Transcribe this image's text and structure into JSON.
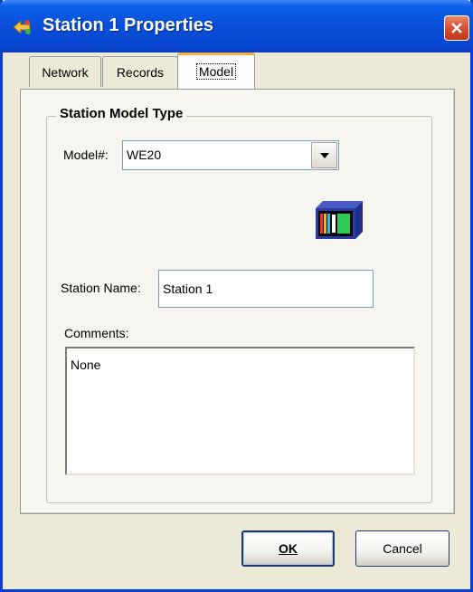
{
  "window": {
    "title": "Station 1 Properties",
    "close_glyph": "✕"
  },
  "tabs": [
    {
      "label": "Network",
      "active": false
    },
    {
      "label": "Records",
      "active": false
    },
    {
      "label": "Model",
      "active": true
    }
  ],
  "model_tab": {
    "group_title": "Station Model Type",
    "model_label": "Model#:",
    "model_value": "WE20",
    "station_name_label": "Station Name:",
    "station_name_value": "Station 1",
    "comments_label": "Comments:",
    "comments_value": "None"
  },
  "buttons": {
    "ok_label": "OK",
    "cancel_label": "Cancel"
  },
  "icons": {
    "title": "station-properties-icon",
    "model_image": "station-device-icon",
    "dropdown": "dropdown-arrow-icon",
    "close": "close-icon"
  },
  "colors": {
    "titlebar": "#0a4fd9",
    "close_button": "#d65033",
    "active_tab_accent": "#f9b041",
    "panel_background": "#f6f5f0",
    "window_background": "#ece9d8"
  }
}
